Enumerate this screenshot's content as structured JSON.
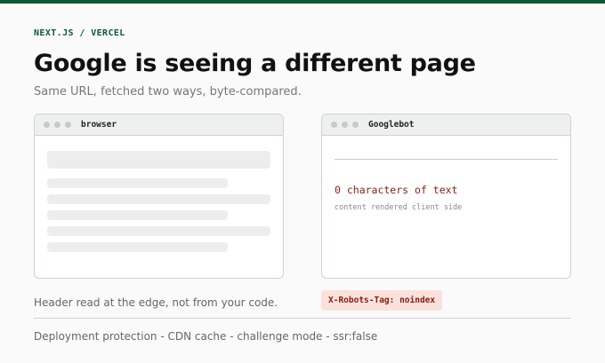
{
  "header": {
    "eyebrow": "NEXT.JS / VERCEL",
    "title": "Google is seeing a different page",
    "subtitle": "Same URL, fetched two ways, byte-compared."
  },
  "browser_window": {
    "label": "browser"
  },
  "googlebot_window": {
    "label": "Googlebot",
    "count_text": "0 characters of text",
    "note": "content rendered client side"
  },
  "caption": "Header read at the edge, not from your code.",
  "robots_tag": "X-Robots-Tag: noindex",
  "footer": "Deployment protection - CDN cache - challenge mode - ssr:false",
  "colors": {
    "accent": "#0b5a36",
    "alert_text": "#8b1d10",
    "alert_bg": "#fbe1dc"
  }
}
